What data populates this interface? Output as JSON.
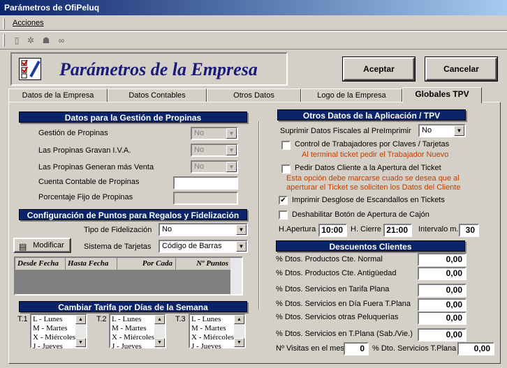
{
  "window": {
    "title": "Parámetros de OfiPeluq"
  },
  "menu": {
    "acciones": "Acciones"
  },
  "toolbar": {
    "icons": [
      "document-icon",
      "gear-icon",
      "people-icon",
      "binoculars-icon"
    ]
  },
  "header": {
    "title": "Parámetros de la Empresa",
    "aceptar": "Aceptar",
    "cancelar": "Cancelar"
  },
  "tabs": [
    "Datos de la Empresa",
    "Datos Contables",
    "Otros Datos",
    "Logo de la Empresa",
    "Globales TPV"
  ],
  "propinas": {
    "title": "Datos para la Gestión de Propinas",
    "gestion_label": "Gestión de Propinas",
    "gestion_value": "No",
    "iva_label": "Las Propinas Gravan I.V.A.",
    "iva_value": "No",
    "venta_label": "Las Propinas Generan más Venta",
    "venta_value": "No",
    "cuenta_label": "Cuenta Contable de Propinas",
    "cuenta_value": "",
    "porcentaje_label": "Porcentaje Fijo de Propinas",
    "porcentaje_value": ""
  },
  "puntos": {
    "title": "Configuración de Puntos para Regalos y Fidelización",
    "tipo_label": "Tipo de Fidelización",
    "tipo_value": "No",
    "sistema_label": "Sistema de Tarjetas",
    "sistema_value": "Código de Barras",
    "modificar": "Modificar",
    "columns": [
      "Desde Fecha",
      "Hasta Fecha",
      "Por Cada",
      "Nº Puntos"
    ]
  },
  "tarifa": {
    "title": "Cambiar Tarifa por Días de la Semana",
    "t1": "T.1",
    "t2": "T.2",
    "t3": "T.3",
    "days": [
      "L - Lunes",
      "M - Martes",
      "X - Miércoles",
      "J - Jueves"
    ]
  },
  "otros": {
    "title": "Otros Datos de la Aplicación / TPV",
    "suprimir_label": "Suprimir Datos Fiscales al PreImprimir",
    "suprimir_value": "No",
    "control_label": "Control de Trabajadores por Claves / Tarjetas",
    "control_note": "Al terminal ticket pedir el Trabajador Nuevo",
    "pedir_label": "Pedir Datos Cliente a la Apertura del Ticket",
    "pedir_note1": "Esta opción debe marcarse cuado se desea que al",
    "pedir_note2": "aperturar el Ticket se soliciten los Datos del Cliente",
    "imprimir_label": "Imprimir Desglose de Escandallos en Tickets",
    "deshabilitar_label": "Deshabilitar Botón de Apertura de Cajón",
    "apertura_label": "H.Apertura",
    "apertura_value": "10:00",
    "cierre_label": "H. Cierre",
    "cierre_value": "21:00",
    "intervalo_label": "Intervalo m.",
    "intervalo_value": "30"
  },
  "descuentos": {
    "title": "Descuentos Clientes",
    "rows": [
      {
        "label": "% Dtos. Productos Cte. Normal",
        "value": "0,00"
      },
      {
        "label": "% Dtos. Productos Cte. Antigüedad",
        "value": "0,00"
      },
      {
        "label": "% Dtos. Servicios en Tarifa Plana",
        "value": "0,00"
      },
      {
        "label": "% Dtos. Servicios en Día Fuera T.Plana",
        "value": "0,00"
      },
      {
        "label": "% Dtos. Servicios otras Peluquerías",
        "value": "0,00"
      },
      {
        "label": "% Dtos. Servicios en T.Plana (Sab./Vie.)",
        "value": "0,00"
      }
    ],
    "visitas_label": "Nº Visitas en el mes",
    "visitas_value": "0",
    "dto_tplana_label": "% Dto. Servicios T.Plana",
    "dto_tplana_value": "0,00"
  }
}
